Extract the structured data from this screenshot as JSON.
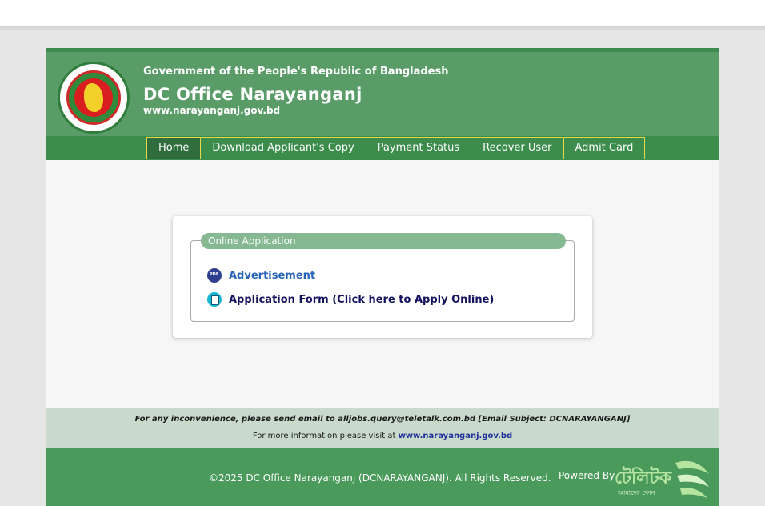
{
  "header": {
    "government": "Government of the People's Republic of Bangladesh",
    "office": "DC Office Narayanganj",
    "website": "www.narayanganj.gov.bd",
    "emblem_icon": "bangladesh-government-emblem"
  },
  "nav": {
    "items": [
      {
        "label": "Home"
      },
      {
        "label": "Download Applicant's Copy"
      },
      {
        "label": "Payment Status"
      },
      {
        "label": "Recover User"
      },
      {
        "label": "Admit Card"
      }
    ]
  },
  "panel": {
    "legend": "Online Application",
    "advertisement": "Advertisement",
    "application_form": "Application Form (Click here to Apply Online)",
    "advertisement_icon": "pdf-icon",
    "application_form_icon": "form-icon"
  },
  "info": {
    "line1": "For any inconvenience, please send email to alljobs.query@teletalk.com.bd [Email Subject: DCNARAYANGANJ]",
    "line2_prefix": "For more information please visit at",
    "line2_link": "www.narayanganj.gov.bd"
  },
  "footer": {
    "copyright": "©2025 DC Office Narayanganj (DCNARAYANGANJ). All Rights Reserved.",
    "powered_by": "Powered By",
    "brand_name": "টেলিটক",
    "brand_tagline": "আমাদের ফোন"
  },
  "colors": {
    "header_green": "#5a9c68",
    "nav_green": "#3c8c4c",
    "nav_border_yellow": "#e5d84a",
    "footer_green": "#4a9a5c",
    "legend_green": "#86b892"
  }
}
